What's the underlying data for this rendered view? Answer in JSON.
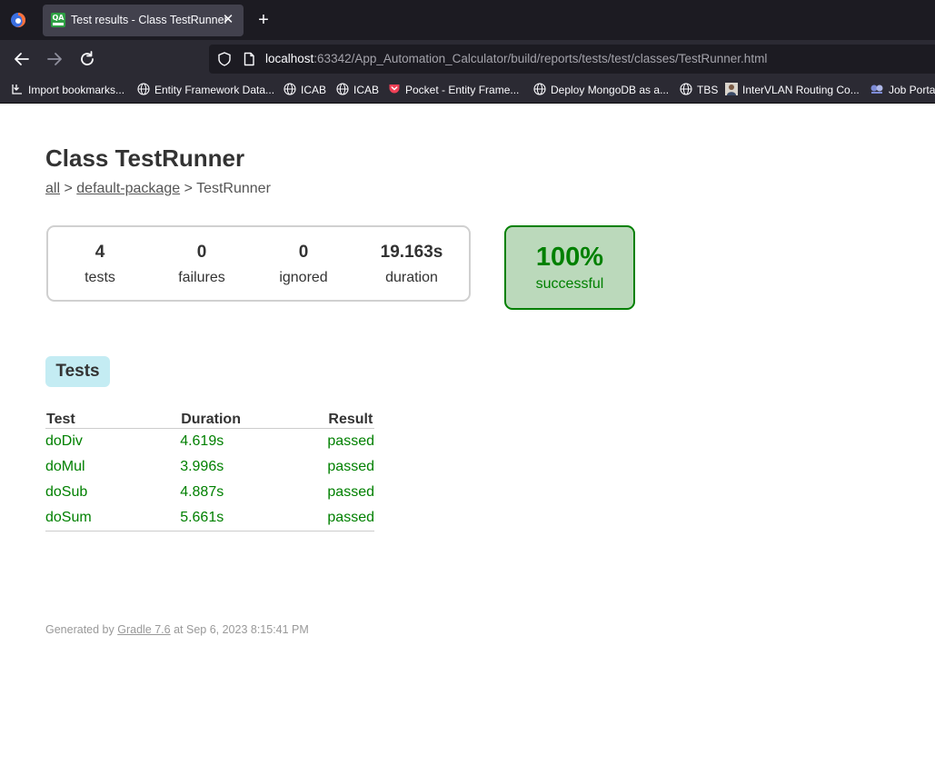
{
  "browser": {
    "tab_title": "Test results - Class TestRunner",
    "tab_favicon_text": "QA",
    "url_host": "localhost",
    "url_rest": ":63342/App_Automation_Calculator/build/reports/tests/test/classes/TestRunner.html",
    "bookmarks": [
      {
        "label": "Import bookmarks...",
        "icon": "import-icon"
      },
      {
        "label": "Entity Framework Data...",
        "icon": "globe-icon"
      },
      {
        "label": "ICAB",
        "icon": "globe-icon"
      },
      {
        "label": "ICAB",
        "icon": "globe-icon"
      },
      {
        "label": "Pocket - Entity Frame...",
        "icon": "pocket-icon"
      },
      {
        "label": "Deploy MongoDB as a...",
        "icon": "globe-icon"
      },
      {
        "label": "TBS",
        "icon": "globe-icon"
      },
      {
        "label": "InterVLAN Routing Co...",
        "icon": "avatar-icon"
      },
      {
        "label": "Job Portal",
        "icon": "job-portal-icon"
      }
    ]
  },
  "report": {
    "title": "Class TestRunner",
    "breadcrumb": {
      "all": "all",
      "sep": ">",
      "package": "default-package",
      "current": "TestRunner"
    },
    "summary": {
      "tests": {
        "value": "4",
        "label": "tests"
      },
      "failures": {
        "value": "0",
        "label": "failures"
      },
      "ignored": {
        "value": "0",
        "label": "ignored"
      },
      "duration": {
        "value": "19.163s",
        "label": "duration"
      }
    },
    "success": {
      "percent": "100%",
      "label": "successful"
    },
    "tab_label": "Tests",
    "table": {
      "headers": [
        "Test",
        "Duration",
        "Result"
      ],
      "rows": [
        {
          "test": "doDiv",
          "duration": "4.619s",
          "result": "passed"
        },
        {
          "test": "doMul",
          "duration": "3.996s",
          "result": "passed"
        },
        {
          "test": "doSub",
          "duration": "4.887s",
          "result": "passed"
        },
        {
          "test": "doSum",
          "duration": "5.661s",
          "result": "passed"
        }
      ]
    },
    "footer": {
      "prefix": "Generated by",
      "link": "Gradle 7.6",
      "suffix": "at Sep 6, 2023 8:15:41 PM"
    }
  },
  "colors": {
    "success_green": "#008000",
    "success_bg": "#bbd9bb",
    "tab_bg": "#c4ecf3",
    "chrome_dark": "#1c1b22"
  }
}
